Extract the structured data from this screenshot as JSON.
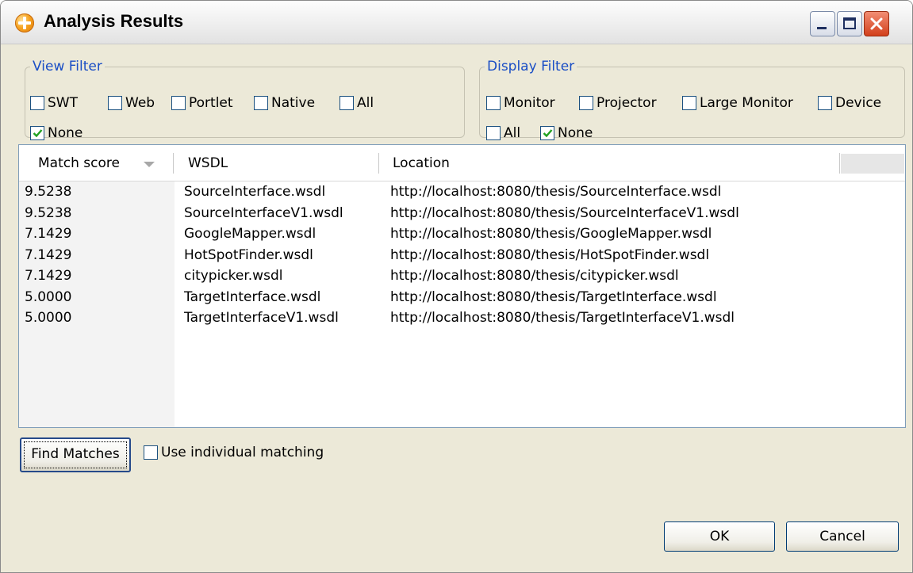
{
  "window": {
    "title": "Analysis Results"
  },
  "view_filter": {
    "legend": "View Filter",
    "options": [
      {
        "label": "SWT",
        "checked": false
      },
      {
        "label": "Web",
        "checked": false
      },
      {
        "label": "Portlet",
        "checked": false
      },
      {
        "label": "Native",
        "checked": false
      },
      {
        "label": "All",
        "checked": false
      },
      {
        "label": "None",
        "checked": true
      }
    ]
  },
  "display_filter": {
    "legend": "Display Filter",
    "options": [
      {
        "label": "Monitor",
        "checked": false
      },
      {
        "label": "Projector",
        "checked": false
      },
      {
        "label": "Large Monitor",
        "checked": false
      },
      {
        "label": "Device",
        "checked": false
      },
      {
        "label": "All",
        "checked": false
      },
      {
        "label": "None",
        "checked": true
      }
    ]
  },
  "table": {
    "columns": [
      "Match score",
      "WSDL",
      "Location"
    ],
    "sorted_by": "Match score",
    "rows": [
      {
        "score": "9.5238",
        "wsdl": "SourceInterface.wsdl",
        "location": "http://localhost:8080/thesis/SourceInterface.wsdl"
      },
      {
        "score": "9.5238",
        "wsdl": "SourceInterfaceV1.wsdl",
        "location": "http://localhost:8080/thesis/SourceInterfaceV1.wsdl"
      },
      {
        "score": "7.1429",
        "wsdl": "GoogleMapper.wsdl",
        "location": "http://localhost:8080/thesis/GoogleMapper.wsdl"
      },
      {
        "score": "7.1429",
        "wsdl": "HotSpotFinder.wsdl",
        "location": "http://localhost:8080/thesis/HotSpotFinder.wsdl"
      },
      {
        "score": "7.1429",
        "wsdl": "citypicker.wsdl",
        "location": "http://localhost:8080/thesis/citypicker.wsdl"
      },
      {
        "score": "5.0000",
        "wsdl": "TargetInterface.wsdl",
        "location": "http://localhost:8080/thesis/TargetInterface.wsdl"
      },
      {
        "score": "5.0000",
        "wsdl": "TargetInterfaceV1.wsdl",
        "location": "http://localhost:8080/thesis/TargetInterfaceV1.wsdl"
      }
    ]
  },
  "actions": {
    "find_matches": "Find Matches",
    "use_individual_matching": {
      "label": "Use individual matching",
      "checked": false
    },
    "ok": "OK",
    "cancel": "Cancel"
  },
  "colors": {
    "legend_text": "#1a4ec5",
    "window_bg": "#ece9d8",
    "checkmark": "#21a121"
  },
  "icons": {
    "app": "orange-crosshair-icon",
    "minimize": "minimize-icon",
    "maximize": "maximize-icon",
    "close": "close-icon",
    "sort": "sort-descending-icon"
  }
}
